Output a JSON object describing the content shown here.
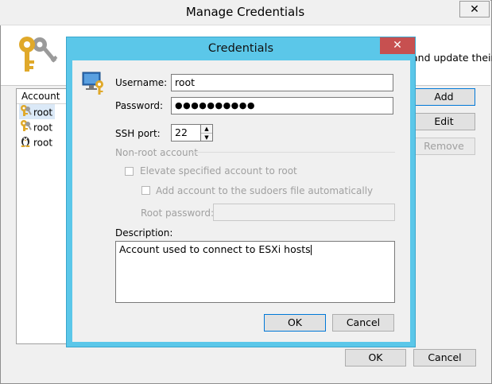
{
  "outer": {
    "title": "Manage Credentials",
    "close_label": "✕",
    "banner_text": "and update their",
    "list_header": "Account",
    "accounts": [
      {
        "name": "root",
        "icon": "key-icon"
      },
      {
        "name": "root",
        "icon": "key-icon"
      },
      {
        "name": "root",
        "icon": "linux-penguin-icon"
      }
    ],
    "buttons": {
      "add": "Add",
      "edit": "Edit",
      "remove": "Remove",
      "ok": "OK",
      "cancel": "Cancel"
    }
  },
  "dialog": {
    "title": "Credentials",
    "close_label": "✕",
    "username_label": "Username:",
    "username_value": "root",
    "password_label": "Password:",
    "password_value": "●●●●●●●●●●",
    "ssh_port_label": "SSH port:",
    "ssh_port_value": "22",
    "nonroot_heading": "Non-root account",
    "elevate_label": "Elevate specified account to root",
    "sudoers_label": "Add account to the sudoers file automatically",
    "root_password_label": "Root password:",
    "root_password_value": "",
    "description_label": "Description:",
    "description_value": "Account used to connect to ESXi hosts",
    "ok_label": "OK",
    "cancel_label": "Cancel"
  },
  "colors": {
    "accent": "#5bc7e9",
    "close_red": "#c75050",
    "key_gold": "#e0a92a",
    "focus_blue": "#0078d7"
  }
}
